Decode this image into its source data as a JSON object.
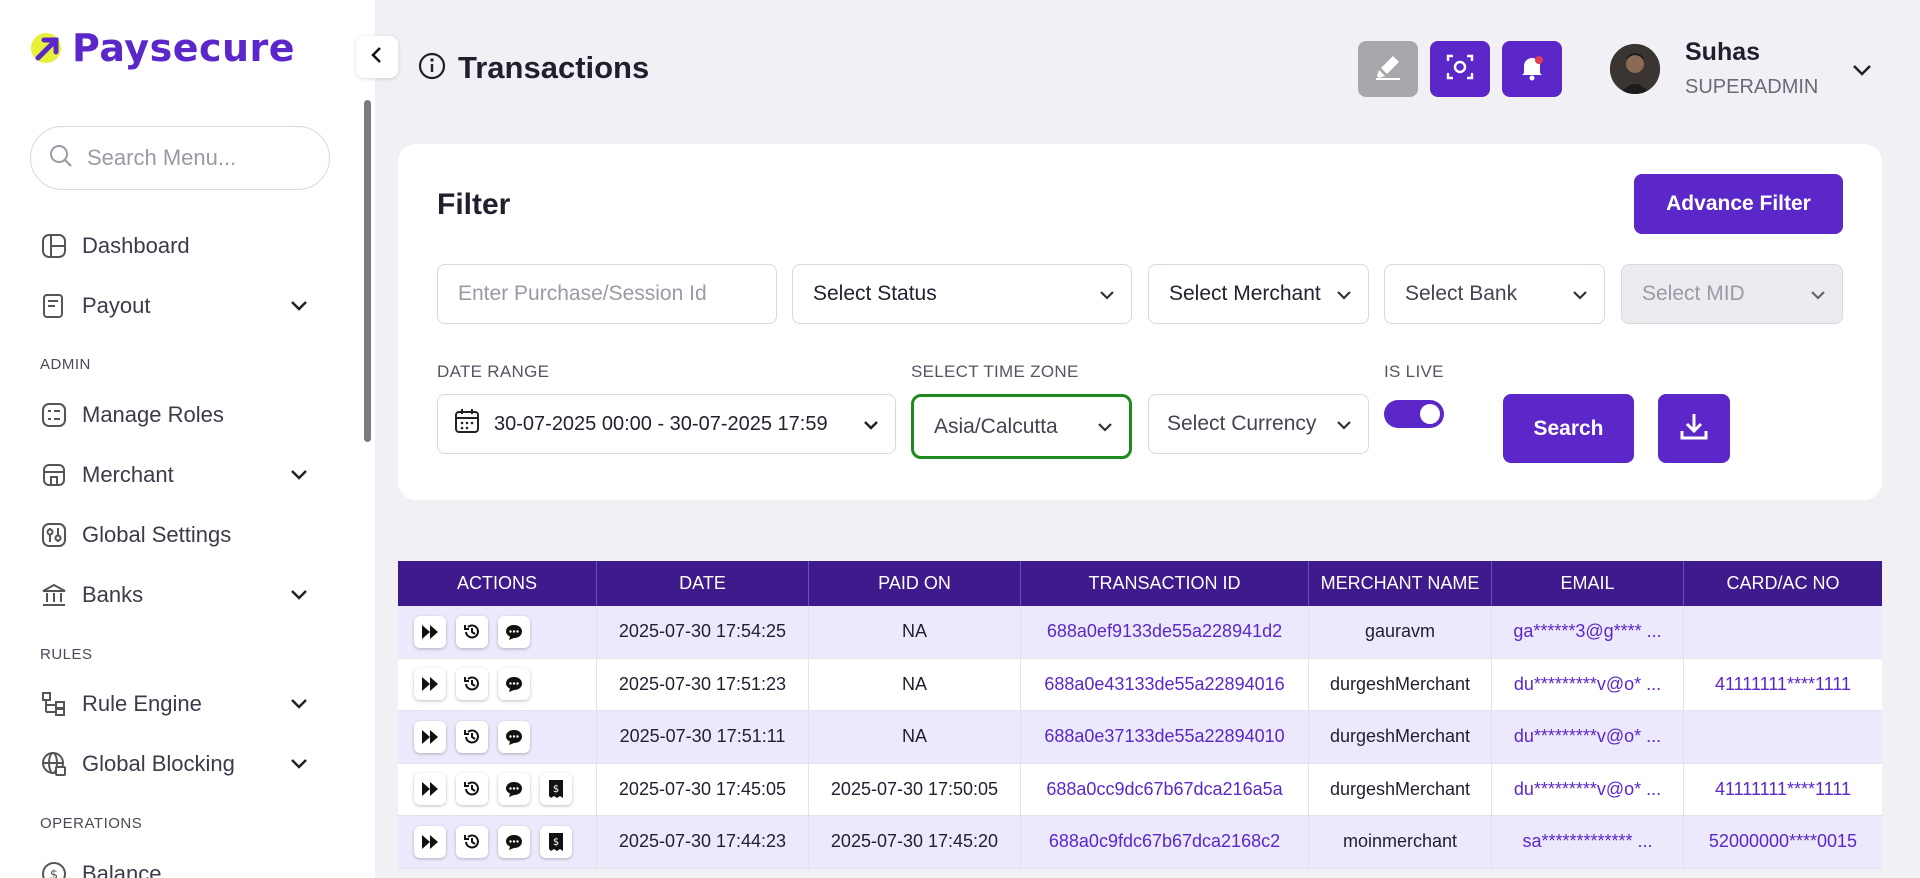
{
  "app": {
    "logo_text": "Paysecure"
  },
  "sidebar": {
    "search_placeholder": "Search Menu...",
    "items": [
      {
        "label": "Dashboard",
        "icon": "dashboard-icon"
      },
      {
        "label": "Payout",
        "icon": "payout-icon"
      },
      {
        "label": "Manage Roles",
        "icon": "roles-icon"
      },
      {
        "label": "Merchant",
        "icon": "merchant-icon"
      },
      {
        "label": "Global Settings",
        "icon": "settings-icon"
      },
      {
        "label": "Banks",
        "icon": "bank-icon"
      },
      {
        "label": "Rule Engine",
        "icon": "rule-engine-icon"
      },
      {
        "label": "Global Blocking",
        "icon": "globe-block-icon"
      },
      {
        "label": "Balance",
        "icon": "balance-icon"
      }
    ],
    "sections": {
      "admin": "ADMIN",
      "rules": "RULES",
      "operations": "OPERATIONS"
    }
  },
  "header": {
    "title": "Transactions",
    "user": {
      "name": "Suhas",
      "role": "SUPERADMIN"
    }
  },
  "filter": {
    "title": "Filter",
    "advance_filter": "Advance Filter",
    "purchase_placeholder": "Enter Purchase/Session Id",
    "status": "Select Status",
    "merchant": "Select Merchant",
    "bank": "Select Bank",
    "mid": "Select MID",
    "date_range_label": "DATE RANGE",
    "date_range": "30-07-2025 00:00 - 30-07-2025 17:59",
    "timezone_label": "SELECT TIME ZONE",
    "timezone": "Asia/Calcutta",
    "currency": "Select Currency",
    "is_live_label": "IS LIVE",
    "is_live": true,
    "search": "Search"
  },
  "table": {
    "columns": [
      "ACTIONS",
      "DATE",
      "PAID ON",
      "TRANSACTION ID",
      "MERCHANT NAME",
      "EMAIL",
      "CARD/AC NO"
    ],
    "rows": [
      {
        "date": "2025-07-30 17:54:25",
        "paid_on": "NA",
        "txn": "688a0ef9133de55a228941d2",
        "merchant": "gauravm",
        "email": "ga******3@g**** ...",
        "card": "",
        "receipt": false
      },
      {
        "date": "2025-07-30 17:51:23",
        "paid_on": "NA",
        "txn": "688a0e43133de55a22894016",
        "merchant": "durgeshMerchant",
        "email": "du*********v@o* ...",
        "card": "41111111****1111",
        "receipt": false
      },
      {
        "date": "2025-07-30 17:51:11",
        "paid_on": "NA",
        "txn": "688a0e37133de55a22894010",
        "merchant": "durgeshMerchant",
        "email": "du*********v@o* ...",
        "card": "",
        "receipt": false
      },
      {
        "date": "2025-07-30 17:45:05",
        "paid_on": "2025-07-30 17:50:05",
        "txn": "688a0cc9dc67b67dca216a5a",
        "merchant": "durgeshMerchant",
        "email": "du*********v@o* ...",
        "card": "41111111****1111",
        "receipt": true
      },
      {
        "date": "2025-07-30 17:44:23",
        "paid_on": "2025-07-30 17:45:20",
        "txn": "688a0c9fdc67b67dca2168c2",
        "merchant": "moinmerchant",
        "email": "sa************* ...",
        "card": "52000000****0015",
        "receipt": true
      }
    ]
  },
  "colors": {
    "accent": "#5b27c9",
    "table_header": "#3e1a8c",
    "row_alt": "#ebe9fb",
    "timezone_border": "#1f8a1f"
  }
}
